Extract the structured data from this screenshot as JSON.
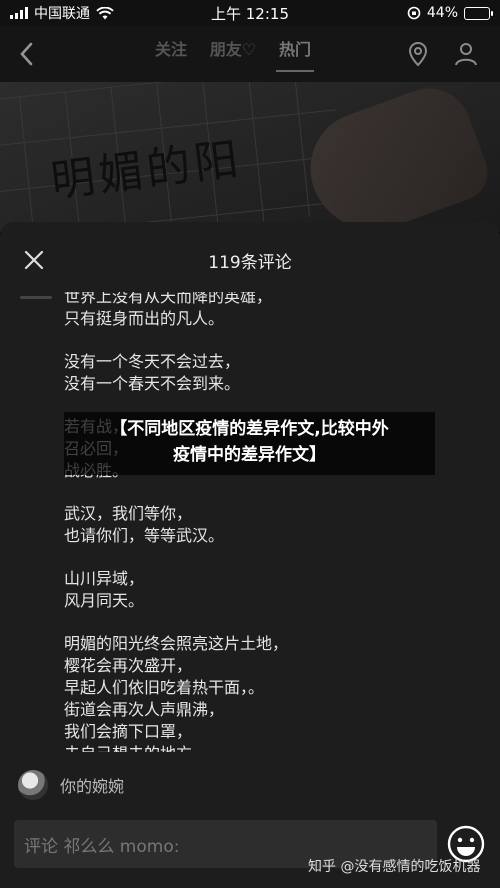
{
  "status_bar": {
    "carrier": "中国联通",
    "time": "上午 12:15",
    "battery": "44%",
    "battery_level": 0.44
  },
  "nav": {
    "tabs": [
      {
        "label": "关注"
      },
      {
        "label": "朋友♡"
      },
      {
        "label": "热门"
      }
    ],
    "active_tab": "热门"
  },
  "photo": {
    "handwriting": "明媚的阳"
  },
  "comments": {
    "title": "119条评论",
    "blocks": [
      [
        "世界上没有从天而降的英雄，",
        "只有挺身而出的凡人。"
      ],
      [
        "没有一个冬天不会过去，",
        "没有一个春天不会到来。"
      ],
      [
        "若有战，",
        "召必回，",
        "战必胜。"
      ],
      [
        "武汉，我们等你，",
        "也请你们，等等武汉。"
      ],
      [
        "山川异域，",
        "风月同天。"
      ],
      [
        "明媚的阳光终会照亮这片土地，",
        "樱花会再次盛开，",
        "早起人们依旧吃着热干面，。",
        "街道会再次人声鼎沸，",
        "我们会摘下口罩，",
        "去自己想去的地方。"
      ]
    ],
    "reply_user": "你的婉婉",
    "input_placeholder": "评论 祁么么 momo:"
  },
  "overlay": {
    "line1": "【不同地区疫情的差异作文,比较中外",
    "line2": "疫情中的差异作文】"
  },
  "watermark": "知乎 @没有感情的吃饭机器"
}
